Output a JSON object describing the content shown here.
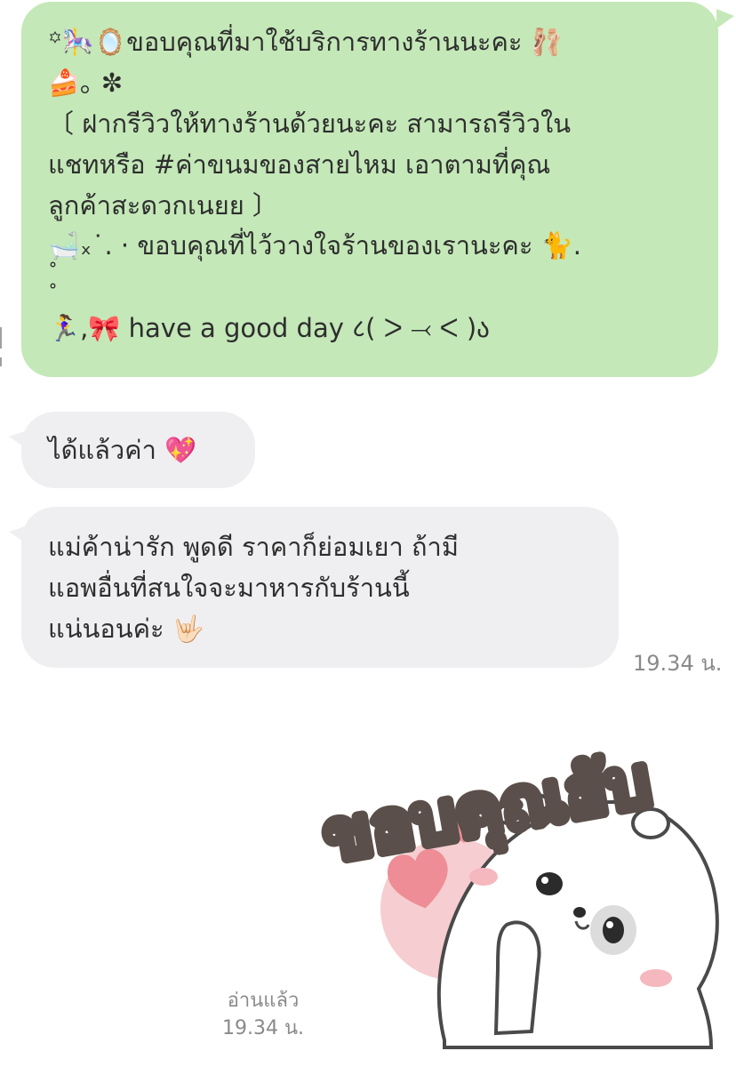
{
  "colors": {
    "outgoing_bubble": "#c4e8b8",
    "incoming_bubble": "#efeff1",
    "text": "#2e2e2e",
    "meta_text": "#8a8a8a"
  },
  "outgoing_message": {
    "lines": [
      "꙳🎠🪞ขอบคุณที่มาใช้บริการทางร้านนะคะ 🩰",
      "🍰｡ ✼",
      "〔 ฝากรีวิวให้ทางร้านด้วยนะคะ สามารถรีวิวใน",
      "แชทหรือ #ค่าขนมของสายไหม เอาตามที่คุณ",
      "ลูกค้าสะดวกเนยย 〕",
      "🛁ₓ˙. · ขอบคุณที่ไว้วางใจร้านของเรานะคะ 🐈.",
      "   ˚",
      "˚",
      "🏃‍♀️,🎀 have a good day ८( ᐳ ⤙ ᐸ )ა"
    ]
  },
  "incoming_messages": [
    {
      "lines": [
        "ได้แล้วค่า 💖"
      ]
    },
    {
      "lines": [
        "แม่ค้าน่ารัก พูดดี ราคาก็ย่อมเยา ถ้ามี",
        "แอพอื่นที่สนใจจะมาหารกับร้านนี้",
        "แน่นอนค่ะ 🤟🏻"
      ],
      "time": "19.34 น."
    }
  ],
  "sticker": {
    "text": "ขอบคุณฮับ",
    "icon": "bear-thank-you-sticker"
  },
  "read_receipt": {
    "status": "อ่านแล้ว",
    "time": "19.34 น."
  }
}
